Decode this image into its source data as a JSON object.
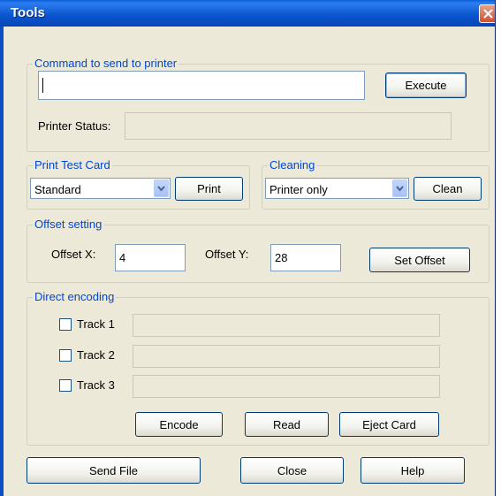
{
  "window": {
    "title": "Tools"
  },
  "command_group": {
    "legend": "Command to send to printer",
    "command_value": "",
    "execute_label": "Execute",
    "status_label": "Printer Status:",
    "status_value": ""
  },
  "print_test_group": {
    "legend": "Print Test Card",
    "selected": "Standard",
    "print_label": "Print"
  },
  "cleaning_group": {
    "legend": "Cleaning",
    "selected": "Printer only",
    "clean_label": "Clean"
  },
  "offset_group": {
    "legend": "Offset setting",
    "x_label": "Offset X:",
    "x_value": "4",
    "y_label": "Offset Y:",
    "y_value": "28",
    "set_label": "Set Offset"
  },
  "encoding_group": {
    "legend": "Direct encoding",
    "tracks": [
      {
        "label": "Track 1",
        "checked": false,
        "value": ""
      },
      {
        "label": "Track 2",
        "checked": false,
        "value": ""
      },
      {
        "label": "Track 3",
        "checked": false,
        "value": ""
      }
    ],
    "encode_label": "Encode",
    "read_label": "Read",
    "eject_label": "Eject Card"
  },
  "footer": {
    "send_file_label": "Send File",
    "close_label": "Close",
    "help_label": "Help"
  },
  "colors": {
    "title_bar": "#0b57d0",
    "legend_text": "#0046d5",
    "dialog_bg": "#ece9d8",
    "close_button": "#d2502c"
  }
}
